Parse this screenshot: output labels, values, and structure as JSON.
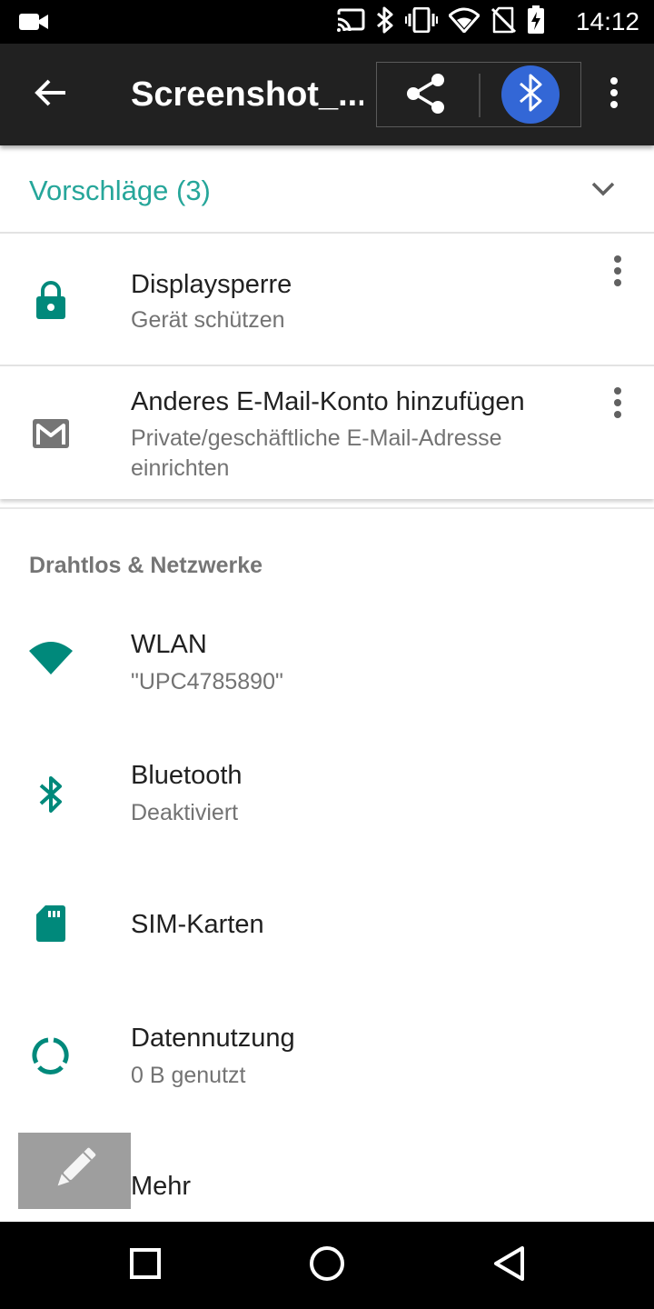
{
  "status_bar": {
    "time": "14:12",
    "icons": [
      "video-camera-icon",
      "cast-icon",
      "bluetooth-icon",
      "vibrate-icon",
      "wifi-icon",
      "no-sim-icon",
      "battery-charging-icon"
    ]
  },
  "app_bar": {
    "title": "Screenshot_...",
    "back_icon": "arrow-back-icon",
    "share_icon": "share-icon",
    "bluetooth_share_icon": "bluetooth-icon",
    "overflow_icon": "more-vert-icon"
  },
  "suggestions": {
    "title": "Vorschläge (3)",
    "items": [
      {
        "title": "Displaysperre",
        "subtitle": "Gerät schützen",
        "icon": "lock-icon"
      },
      {
        "title": "Anderes E-Mail-Konto hinzufügen",
        "subtitle": "Private/geschäftliche E-Mail-Adresse einrichten",
        "icon": "gmail-icon"
      }
    ]
  },
  "section": {
    "header": "Drahtlos & Netzwerke",
    "items": [
      {
        "title": "WLAN",
        "subtitle": "\"UPC4785890\"",
        "icon": "wifi-icon"
      },
      {
        "title": "Bluetooth",
        "subtitle": "Deaktiviert",
        "icon": "bluetooth-icon"
      },
      {
        "title": "SIM-Karten",
        "subtitle": "",
        "icon": "sim-card-icon"
      },
      {
        "title": "Datennutzung",
        "subtitle": "0 B genutzt",
        "icon": "data-usage-icon"
      },
      {
        "title": "Mehr",
        "subtitle": "",
        "icon": "more-horiz-icon"
      }
    ]
  },
  "nav_bar": {
    "icons": [
      "recents-icon",
      "home-icon",
      "back-icon"
    ]
  },
  "colors": {
    "accent": "#26a69a",
    "icon_teal": "#00897b",
    "app_bar": "#212121",
    "bluetooth_blue": "#3367d6"
  }
}
